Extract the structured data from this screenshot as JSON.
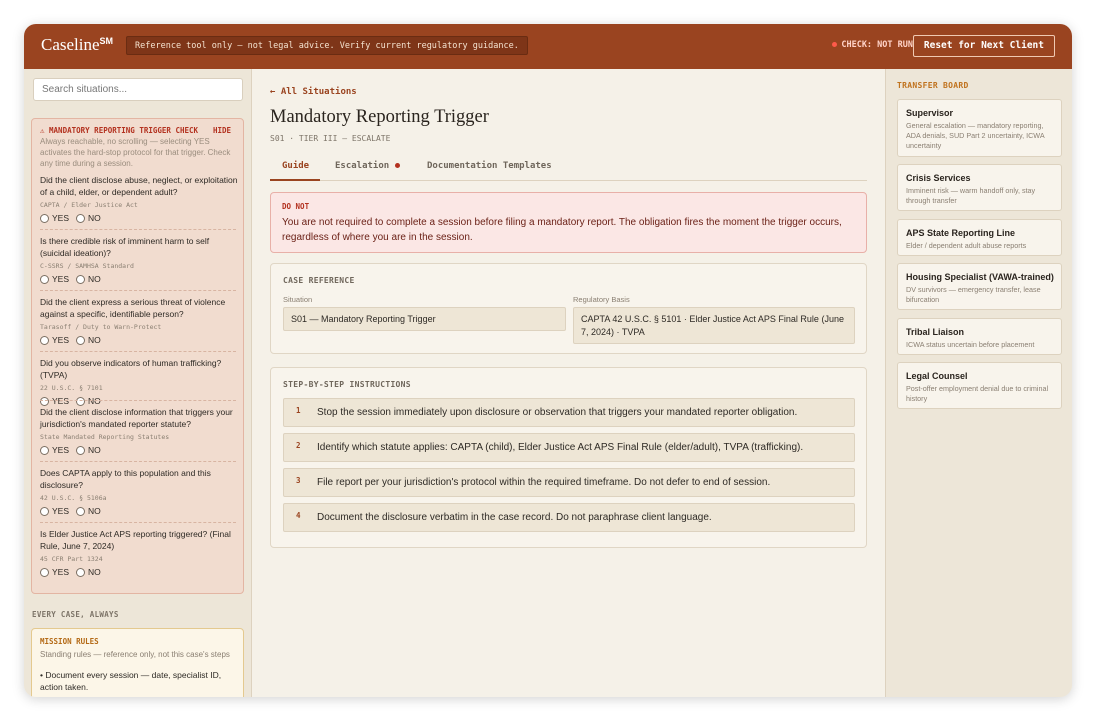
{
  "header": {
    "app_name": "Caseline",
    "app_mark": "SM",
    "disclaimer": "Reference tool only — not legal advice. Verify current regulatory guidance.",
    "check_status": "CHECK: NOT RUN",
    "reset_label": "Reset for Next Client"
  },
  "sidebar": {
    "search_placeholder": "Search situations...",
    "trigger": {
      "title": "⚠ MANDATORY REPORTING TRIGGER CHECK",
      "hide_label": "HIDE",
      "description": "Always reachable, no scrolling — selecting YES activates the hard-stop protocol for that trigger. Check any time during a session.",
      "yes_label": "YES",
      "no_label": "NO",
      "questions": [
        {
          "text": "Did the client disclose abuse, neglect, or exploitation of a child, elder, or dependent adult?",
          "ref": "CAPTA / Elder Justice Act"
        },
        {
          "text": "Is there credible risk of imminent harm to self (suicidal ideation)?",
          "ref": "C-SSRS / SAMHSA Standard"
        },
        {
          "text": "Did the client express a serious threat of violence against a specific, identifiable person?",
          "ref": "Tarasoff / Duty to Warn-Protect"
        },
        {
          "text": "Did you observe indicators of human trafficking? (TVPA)",
          "ref": "22 U.S.C. § 7101"
        },
        {
          "text": "Did the client disclose information that triggers your jurisdiction's mandated reporter statute?",
          "ref": "State Mandated Reporting Statutes"
        },
        {
          "text": "Does CAPTA apply to this population and this disclosure?",
          "ref": "42 U.S.C. § 5106a"
        },
        {
          "text": "Is Elder Justice Act APS reporting triggered? (Final Rule, June 7, 2024)",
          "ref": "45 CFR Part 1324"
        }
      ]
    },
    "every_case_label": "EVERY CASE, ALWAYS",
    "mission": {
      "title": "MISSION RULES",
      "subtitle": "Standing rules — reference only, not this case's steps",
      "rule1": "• Document every session — date, specialist ID, action taken."
    }
  },
  "main": {
    "back_link": "← All Situations",
    "title": "Mandatory Reporting Trigger",
    "meta": "S01 · TIER III — ESCALATE",
    "tabs": [
      "Guide",
      "Escalation",
      "Documentation Templates"
    ],
    "donot": {
      "heading": "DO NOT",
      "text": "You are not required to complete a session before filing a mandatory report. The obligation fires the moment the trigger occurs, regardless of where you are in the session."
    },
    "case_ref": {
      "heading": "CASE REFERENCE",
      "situation_label": "Situation",
      "situation_value": "S01 — Mandatory Reporting Trigger",
      "basis_label": "Regulatory Basis",
      "basis_value": "CAPTA 42 U.S.C. § 5101 · Elder Justice Act APS Final Rule (June 7, 2024) · TVPA"
    },
    "steps": {
      "heading": "STEP-BY-STEP INSTRUCTIONS",
      "items": [
        {
          "num": "1",
          "text": "Stop the session immediately upon disclosure or observation that triggers your mandated reporter obligation."
        },
        {
          "num": "2",
          "text": "Identify which statute applies: CAPTA (child), Elder Justice Act APS Final Rule (elder/adult), TVPA (trafficking)."
        },
        {
          "num": "3",
          "text": "File report per your jurisdiction's protocol within the required timeframe. Do not defer to end of session."
        },
        {
          "num": "4",
          "text": "Document the disclosure verbatim in the case record. Do not paraphrase client language."
        }
      ]
    }
  },
  "transfer_board": {
    "heading": "TRANSFER BOARD",
    "cards": [
      {
        "title": "Supervisor",
        "desc": "General escalation — mandatory reporting, ADA denials, SUD Part 2 uncertainty, ICWA uncertainty"
      },
      {
        "title": "Crisis Services",
        "desc": "Imminent risk — warm handoff only, stay through transfer"
      },
      {
        "title": "APS State Reporting Line",
        "desc": "Elder / dependent adult abuse reports"
      },
      {
        "title": "Housing Specialist (VAWA-trained)",
        "desc": "DV survivors — emergency transfer, lease bifurcation"
      },
      {
        "title": "Tribal Liaison",
        "desc": "ICWA status uncertain before placement"
      },
      {
        "title": "Legal Counsel",
        "desc": "Post-offer employment denial due to criminal history"
      }
    ]
  },
  "colors": {
    "brand": "#9a4420",
    "alert": "#b3311f",
    "transfer_accent": "#c0721d"
  }
}
